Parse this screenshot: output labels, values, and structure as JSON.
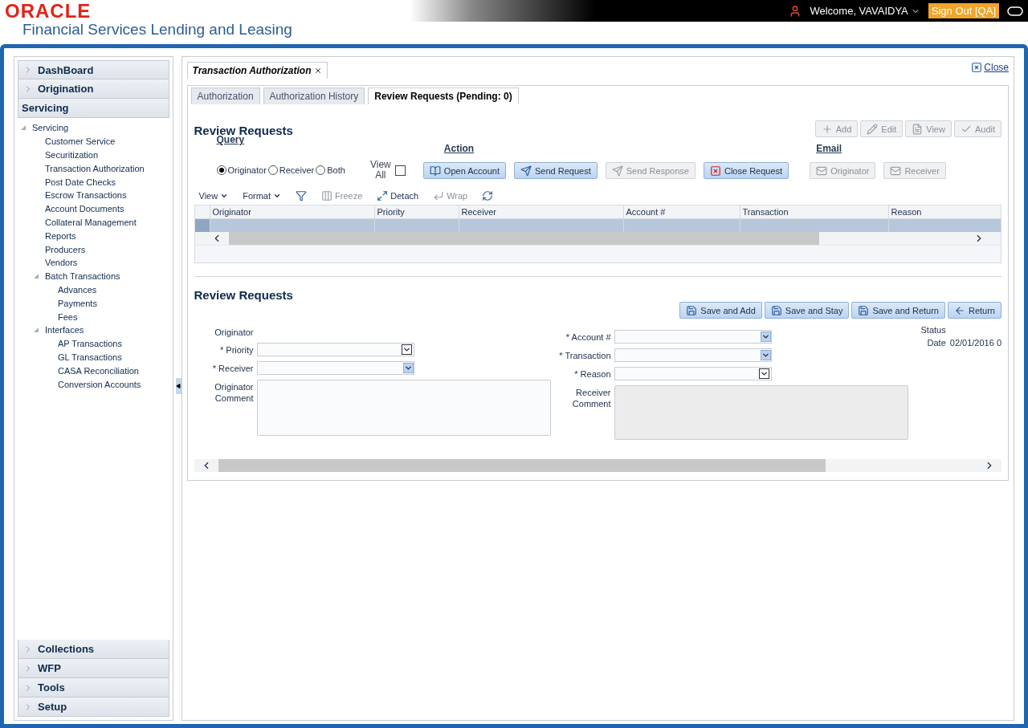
{
  "header": {
    "brand": "ORACLE",
    "product": "Financial Services Lending and Leasing",
    "welcome": "Welcome, VAVAIDYA",
    "sign_out": "Sign Out [QA]"
  },
  "sidebar": {
    "sections": [
      {
        "label": "DashBoard",
        "expanded": false
      },
      {
        "label": "Origination",
        "expanded": false
      },
      {
        "label": "Servicing",
        "expanded": true,
        "items": [
          {
            "label": "Servicing",
            "expanded": true,
            "children": [
              {
                "label": "Customer Service"
              },
              {
                "label": "Securitization"
              },
              {
                "label": "Transaction Authorization"
              },
              {
                "label": "Post Date Checks"
              },
              {
                "label": "Escrow Transactions"
              },
              {
                "label": "Account Documents"
              },
              {
                "label": "Collateral Management"
              },
              {
                "label": "Reports"
              },
              {
                "label": "Producers"
              },
              {
                "label": "Vendors"
              },
              {
                "label": "Batch Transactions",
                "expanded": true,
                "children": [
                  {
                    "label": "Advances"
                  },
                  {
                    "label": "Payments"
                  },
                  {
                    "label": "Fees"
                  }
                ]
              },
              {
                "label": "Interfaces",
                "expanded": true,
                "children": [
                  {
                    "label": "AP Transactions"
                  },
                  {
                    "label": "GL Transactions"
                  },
                  {
                    "label": "CASA Reconciliation"
                  },
                  {
                    "label": "Conversion Accounts"
                  }
                ]
              }
            ]
          }
        ]
      },
      {
        "label": "Collections",
        "expanded": false
      },
      {
        "label": "WFP",
        "expanded": false
      },
      {
        "label": "Tools",
        "expanded": false
      },
      {
        "label": "Setup",
        "expanded": false
      }
    ]
  },
  "page_tab": {
    "label": "Transaction Authorization"
  },
  "close_link": "Close",
  "tabs": [
    {
      "label": "Authorization",
      "selected": false
    },
    {
      "label": "Authorization History",
      "selected": false
    },
    {
      "label": "Review Requests (Pending: 0)",
      "selected": true
    }
  ],
  "list_section": {
    "title": "Review Requests",
    "toolbar_buttons": [
      {
        "label": "Add",
        "disabled": true
      },
      {
        "label": "Edit",
        "disabled": true
      },
      {
        "label": "View",
        "disabled": true
      },
      {
        "label": "Audit",
        "disabled": true
      }
    ],
    "query": {
      "heading": "Query",
      "options": [
        {
          "label": "Originator",
          "selected": true
        },
        {
          "label": "Receiver",
          "selected": false
        },
        {
          "label": "Both",
          "selected": false
        }
      ],
      "view_all": {
        "label": "View All",
        "checked": false
      }
    },
    "action": {
      "heading": "Action",
      "buttons": [
        {
          "label": "Open Account",
          "disabled": false
        },
        {
          "label": "Send Request",
          "disabled": false
        },
        {
          "label": "Send Response",
          "disabled": true
        },
        {
          "label": "Close Request",
          "disabled": false
        }
      ]
    },
    "email": {
      "heading": "Email",
      "buttons": [
        {
          "label": "Originator",
          "disabled": true
        },
        {
          "label": "Receiver",
          "disabled": true
        }
      ]
    },
    "table_toolbar": [
      {
        "kind": "menu",
        "label": "View",
        "disabled": false
      },
      {
        "kind": "menu",
        "label": "Format",
        "disabled": false
      },
      {
        "kind": "icon",
        "disabled": false
      },
      {
        "kind": "button",
        "label": "Freeze",
        "disabled": true
      },
      {
        "kind": "button",
        "label": "Detach",
        "disabled": false
      },
      {
        "kind": "button",
        "label": "Wrap",
        "disabled": true
      },
      {
        "kind": "icon",
        "disabled": false
      }
    ],
    "columns": [
      "Originator",
      "Priority",
      "Receiver",
      "Account #",
      "Transaction",
      "Reason"
    ],
    "rows": [
      {
        "selected": true
      }
    ]
  },
  "form_section": {
    "title": "Review Requests",
    "buttons": [
      "Save and Add",
      "Save and Stay",
      "Save and Return",
      "Return"
    ],
    "left_fields": [
      {
        "label": "Originator",
        "kind": "label"
      },
      {
        "label": "* Priority",
        "kind": "select"
      },
      {
        "label": "* Receiver",
        "kind": "lookup"
      },
      {
        "label": "Originator Comment",
        "kind": "textarea",
        "disabled": false
      }
    ],
    "right_fields": [
      {
        "label": "* Account #",
        "kind": "lookup"
      },
      {
        "label": "* Transaction",
        "kind": "lookup"
      },
      {
        "label": "* Reason",
        "kind": "select"
      },
      {
        "label": "Receiver Comment",
        "kind": "textarea",
        "disabled": true
      }
    ],
    "status": {
      "label": "Status",
      "date_label": "Date",
      "date_value": "02/01/2016 0"
    }
  }
}
